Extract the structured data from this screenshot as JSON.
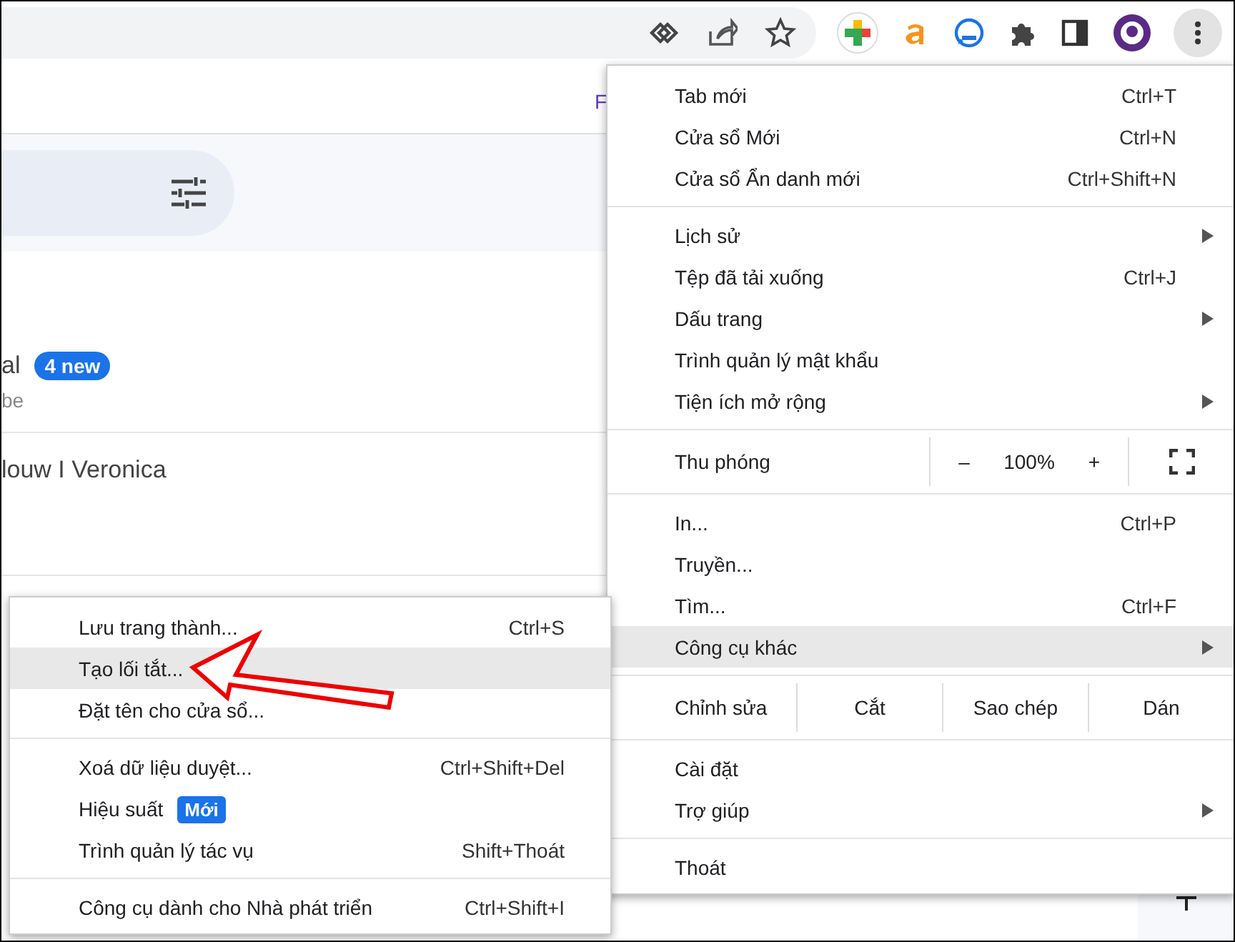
{
  "page": {
    "cut_text": "F",
    "list": [
      {
        "title": "al",
        "badge": "4 new",
        "subtitle": "be"
      },
      {
        "title": "louw I Veronica"
      }
    ]
  },
  "menu": {
    "sections": [
      [
        {
          "kind": "item",
          "label": "Tab mới",
          "shortcut": "Ctrl+T",
          "submenu": false,
          "selected": false
        },
        {
          "kind": "item",
          "label": "Cửa sổ Mới",
          "shortcut": "Ctrl+N",
          "submenu": false,
          "selected": false
        },
        {
          "kind": "item",
          "label": "Cửa sổ Ẩn danh mới",
          "shortcut": "Ctrl+Shift+N",
          "submenu": false,
          "selected": false
        }
      ],
      [
        {
          "kind": "item",
          "label": "Lịch sử",
          "submenu": true,
          "selected": false
        },
        {
          "kind": "item",
          "label": "Tệp đã tải xuống",
          "shortcut": "Ctrl+J",
          "submenu": false,
          "selected": false
        },
        {
          "kind": "item",
          "label": "Dấu trang",
          "submenu": true,
          "selected": false
        },
        {
          "kind": "item",
          "label": "Trình quản lý mật khẩu",
          "submenu": false,
          "selected": false
        },
        {
          "kind": "item",
          "label": "Tiện ích mở rộng",
          "submenu": true,
          "selected": false
        }
      ],
      [
        {
          "kind": "zoom",
          "label": "Thu phóng",
          "minus": "–",
          "value": "100%",
          "plus": "+"
        }
      ],
      [
        {
          "kind": "item",
          "label": "In...",
          "shortcut": "Ctrl+P",
          "submenu": false,
          "selected": false
        },
        {
          "kind": "item",
          "label": "Truyền...",
          "submenu": false,
          "selected": false
        },
        {
          "kind": "item",
          "label": "Tìm...",
          "shortcut": "Ctrl+F",
          "submenu": false,
          "selected": false
        },
        {
          "kind": "item",
          "label": "Công cụ khác",
          "submenu": true,
          "selected": true
        }
      ],
      [
        {
          "kind": "edit",
          "label": "Chỉnh sửa",
          "actions": [
            "Cắt",
            "Sao chép",
            "Dán"
          ]
        }
      ],
      [
        {
          "kind": "item",
          "label": "Cài đặt",
          "submenu": false,
          "selected": false
        },
        {
          "kind": "item",
          "label": "Trợ giúp",
          "submenu": true,
          "selected": false
        }
      ],
      [
        {
          "kind": "item",
          "label": "Thoát",
          "submenu": false,
          "selected": false
        }
      ]
    ]
  },
  "submenu": {
    "sections": [
      [
        {
          "label": "Lưu trang thành...",
          "shortcut": "Ctrl+S",
          "selected": false
        },
        {
          "label": "Tạo lối tắt...",
          "selected": true
        },
        {
          "label": "Đặt tên cho cửa sổ...",
          "selected": false
        }
      ],
      [
        {
          "label": "Xoá dữ liệu duyệt...",
          "shortcut": "Ctrl+Shift+Del",
          "selected": false
        },
        {
          "label": "Hiệu suất",
          "badge": "Mới",
          "selected": false
        },
        {
          "label": "Trình quản lý tác vụ",
          "shortcut": "Shift+Thoát",
          "selected": false
        }
      ],
      [
        {
          "label": "Công cụ dành cho Nhà phát triển",
          "shortcut": "Ctrl+Shift+I",
          "selected": false
        }
      ]
    ]
  }
}
